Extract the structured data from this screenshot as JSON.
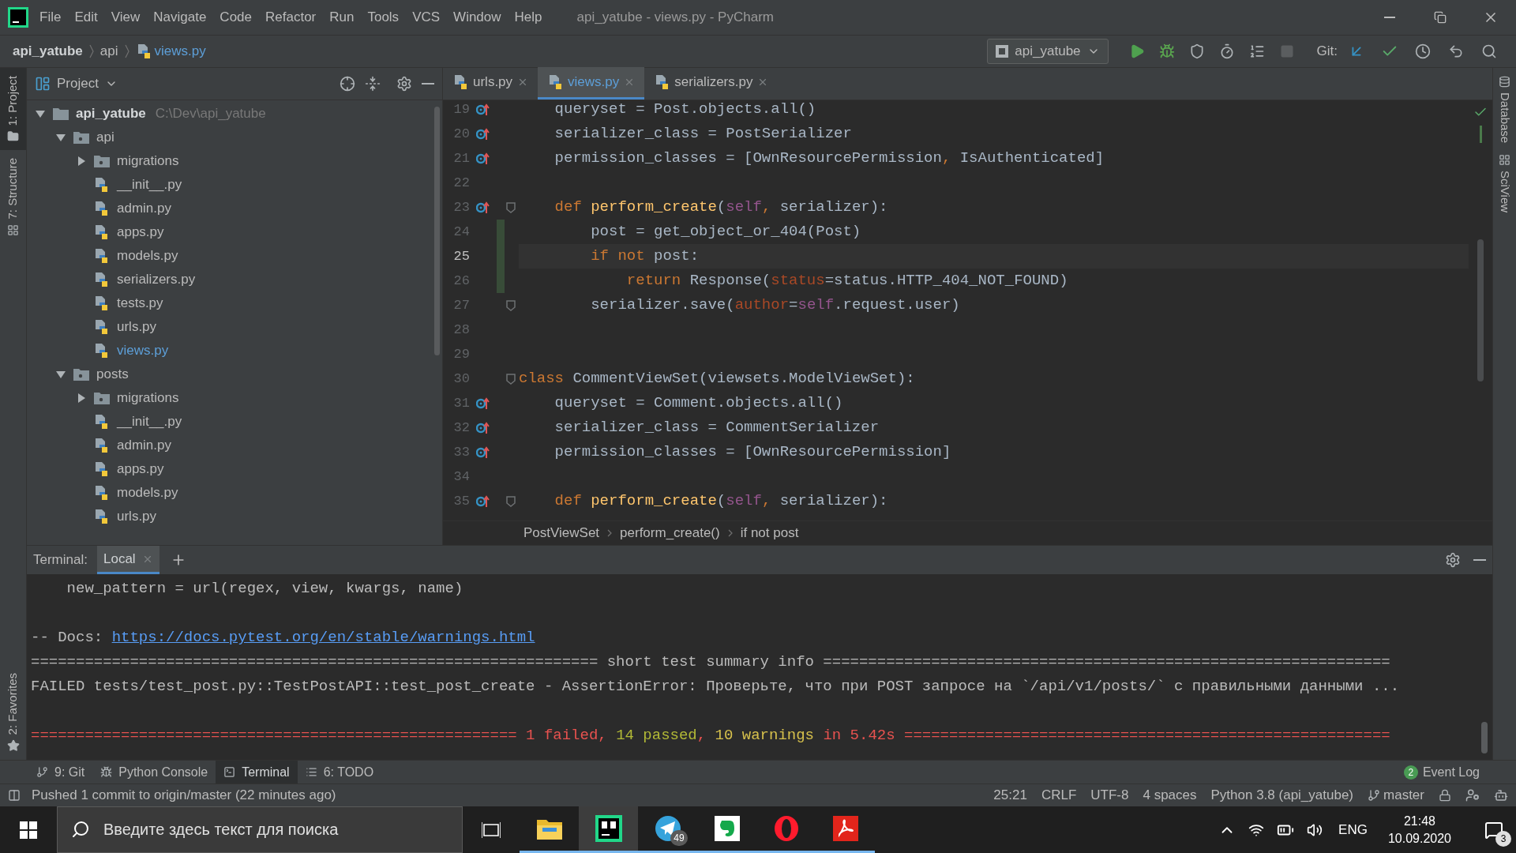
{
  "window": {
    "title": "api_yatube - views.py - PyCharm"
  },
  "menu": [
    "File",
    "Edit",
    "View",
    "Navigate",
    "Code",
    "Refactor",
    "Run",
    "Tools",
    "VCS",
    "Window",
    "Help"
  ],
  "nav": {
    "breadcrumbs": [
      {
        "label": "api_yatube",
        "kind": "project"
      },
      {
        "label": "api",
        "kind": "folder"
      },
      {
        "label": "views.py",
        "kind": "file"
      }
    ],
    "run_config": "api_yatube",
    "run_buttons": [
      {
        "kind": "run",
        "disabled": false
      },
      {
        "kind": "debug",
        "disabled": false
      },
      {
        "kind": "coverage",
        "disabled": false
      },
      {
        "kind": "profile",
        "disabled": false
      },
      {
        "kind": "concurrency",
        "disabled": false
      },
      {
        "kind": "stop",
        "disabled": true
      }
    ],
    "git_label": "Git:"
  },
  "left_strip": [
    {
      "label": "1: Project",
      "selected": true,
      "kind": "project"
    },
    {
      "label": "7: Structure",
      "selected": false,
      "kind": "structure"
    }
  ],
  "left_strip_bottom": [
    {
      "label": "2: Favorites",
      "selected": false,
      "kind": "favorites"
    }
  ],
  "right_strip": [
    {
      "label": "Database",
      "kind": "database"
    },
    {
      "label": "SciView",
      "kind": "sciview"
    }
  ],
  "project": {
    "title": "Project",
    "tree": [
      {
        "label": "api_yatube",
        "hint": "C:\\Dev\\api_yatube",
        "kind": "project",
        "expanded": true,
        "children": [
          {
            "label": "api",
            "kind": "package",
            "expanded": true,
            "children": [
              {
                "label": "migrations",
                "kind": "package",
                "expanded": false
              },
              {
                "label": "__init__.py",
                "kind": "file",
                "active": false
              },
              {
                "label": "admin.py",
                "kind": "file",
                "active": false
              },
              {
                "label": "apps.py",
                "kind": "file",
                "active": false
              },
              {
                "label": "models.py",
                "kind": "file",
                "active": false
              },
              {
                "label": "serializers.py",
                "kind": "file",
                "active": false
              },
              {
                "label": "tests.py",
                "kind": "file",
                "active": false
              },
              {
                "label": "urls.py",
                "kind": "file",
                "active": false
              },
              {
                "label": "views.py",
                "kind": "file",
                "active": true
              }
            ]
          },
          {
            "label": "posts",
            "kind": "package",
            "expanded": true,
            "children": [
              {
                "label": "migrations",
                "kind": "package",
                "expanded": false
              },
              {
                "label": "__init__.py",
                "kind": "file",
                "active": false
              },
              {
                "label": "admin.py",
                "kind": "file",
                "active": false
              },
              {
                "label": "apps.py",
                "kind": "file",
                "active": false
              },
              {
                "label": "models.py",
                "kind": "file",
                "active": false
              },
              {
                "label": "urls.py",
                "kind": "file",
                "active": false
              }
            ]
          }
        ]
      }
    ]
  },
  "editor": {
    "tabs": [
      {
        "label": "urls.py",
        "selected": false
      },
      {
        "label": "views.py",
        "selected": true
      },
      {
        "label": "serializers.py",
        "selected": false
      }
    ],
    "lines": [
      {
        "number": "19",
        "override": true,
        "fold": false,
        "changed": false,
        "current": false,
        "tokens": [
          {
            "kind": "plain",
            "text": "    queryset = Post.objects.all()"
          }
        ]
      },
      {
        "number": "20",
        "override": true,
        "fold": false,
        "changed": false,
        "current": false,
        "tokens": [
          {
            "kind": "plain",
            "text": "    serializer_class = PostSerializer"
          }
        ]
      },
      {
        "number": "21",
        "override": true,
        "fold": false,
        "changed": false,
        "current": false,
        "tokens": [
          {
            "kind": "plain",
            "text": "    permission_classes = [OwnResourcePermission"
          },
          {
            "kind": "keyword",
            "text": ","
          },
          {
            "kind": "plain",
            "text": " IsAuthenticated]"
          }
        ]
      },
      {
        "number": "22",
        "override": false,
        "fold": false,
        "changed": false,
        "current": false
      },
      {
        "number": "23",
        "override": true,
        "fold": true,
        "changed": false,
        "current": false,
        "tokens": [
          {
            "kind": "keyword",
            "text": "    def "
          },
          {
            "kind": "function",
            "text": "perform_create"
          },
          {
            "kind": "plain",
            "text": "("
          },
          {
            "kind": "self",
            "text": "self"
          },
          {
            "kind": "keyword",
            "text": ","
          },
          {
            "kind": "plain",
            "text": " serializer):"
          }
        ]
      },
      {
        "number": "24",
        "override": false,
        "fold": false,
        "changed": true,
        "current": false,
        "tokens": [
          {
            "kind": "plain",
            "text": "        post = get_object_or_404(Post)"
          }
        ]
      },
      {
        "number": "25",
        "override": false,
        "fold": false,
        "changed": true,
        "current": true,
        "tokens": [
          {
            "kind": "keyword",
            "text": "        if not"
          },
          {
            "kind": "plain",
            "text": " post:"
          }
        ]
      },
      {
        "number": "26",
        "override": false,
        "fold": false,
        "changed": true,
        "current": false,
        "tokens": [
          {
            "kind": "keyword",
            "text": "            return"
          },
          {
            "kind": "plain",
            "text": " Response("
          },
          {
            "kind": "param",
            "text": "status"
          },
          {
            "kind": "plain",
            "text": "=status.HTTP_404_NOT_FOUND)"
          }
        ]
      },
      {
        "number": "27",
        "override": false,
        "fold": true,
        "changed": false,
        "current": false,
        "tokens": [
          {
            "kind": "plain",
            "text": "        serializer.save("
          },
          {
            "kind": "param",
            "text": "author"
          },
          {
            "kind": "plain",
            "text": "="
          },
          {
            "kind": "self",
            "text": "self"
          },
          {
            "kind": "plain",
            "text": ".request.user)"
          }
        ]
      },
      {
        "number": "28",
        "override": false,
        "fold": false,
        "changed": false,
        "current": false
      },
      {
        "number": "29",
        "override": false,
        "fold": false,
        "changed": false,
        "current": false
      },
      {
        "number": "30",
        "override": false,
        "fold": true,
        "changed": false,
        "current": false,
        "tokens": [
          {
            "kind": "keyword",
            "text": "class"
          },
          {
            "kind": "plain",
            "text": " CommentViewSet(viewsets.ModelViewSet):"
          }
        ]
      },
      {
        "number": "31",
        "override": true,
        "fold": false,
        "changed": false,
        "current": false,
        "tokens": [
          {
            "kind": "plain",
            "text": "    queryset = Comment.objects.all()"
          }
        ]
      },
      {
        "number": "32",
        "override": true,
        "fold": false,
        "changed": false,
        "current": false,
        "tokens": [
          {
            "kind": "plain",
            "text": "    serializer_class = CommentSerializer"
          }
        ]
      },
      {
        "number": "33",
        "override": true,
        "fold": false,
        "changed": false,
        "current": false,
        "tokens": [
          {
            "kind": "plain",
            "text": "    permission_classes = [OwnResourcePermission]"
          }
        ]
      },
      {
        "number": "34",
        "override": false,
        "fold": false,
        "changed": false,
        "current": false
      },
      {
        "number": "35",
        "override": true,
        "fold": true,
        "changed": false,
        "current": false,
        "tokens": [
          {
            "kind": "keyword",
            "text": "    def "
          },
          {
            "kind": "function",
            "text": "perform_create"
          },
          {
            "kind": "plain",
            "text": "("
          },
          {
            "kind": "self",
            "text": "self"
          },
          {
            "kind": "keyword",
            "text": ","
          },
          {
            "kind": "plain",
            "text": " serializer):"
          }
        ]
      }
    ],
    "breadcrumbs": [
      "PostViewSet",
      "perform_create()",
      "if not post"
    ]
  },
  "terminal": {
    "label": "Terminal:",
    "tabs": [
      {
        "label": "Local",
        "selected": true
      }
    ],
    "lines": [
      {
        "kind": "text",
        "text": "    new_pattern = url(regex, view, kwargs, name)"
      },
      {
        "kind": "blank"
      },
      {
        "kind": "docs",
        "text": "-- Docs: ",
        "link": "https://docs.pytest.org/en/stable/warnings.html"
      },
      {
        "kind": "text",
        "text": "=============================================================== short test summary info ==============================================================="
      },
      {
        "kind": "text",
        "text": "FAILED tests/test_post.py::TestPostAPI::test_post_create - AssertionError: Проверьте, что при POST запросе на `/api/v1/posts/` с правильными данными ..."
      },
      {
        "kind": "blank"
      },
      {
        "kind": "result",
        "segments": [
          {
            "text": "====================================================== 1 failed, ",
            "color": "#e8524f"
          },
          {
            "text": "14 passed",
            "color": "#b2b936"
          },
          {
            "text": ", ",
            "color": "#e8524f"
          },
          {
            "text": "10 warnings",
            "color": "#d7c14c"
          },
          {
            "text": " in 5.42s ======================================================",
            "color": "#e8524f"
          }
        ]
      }
    ]
  },
  "tool_buttons": [
    {
      "label": "9: Git",
      "kind": "git",
      "selected": false
    },
    {
      "label": "Python Console",
      "kind": "console",
      "selected": false
    },
    {
      "label": "Terminal",
      "kind": "terminal",
      "selected": true
    },
    {
      "label": "6: TODO",
      "kind": "todo",
      "selected": false
    }
  ],
  "event_log": {
    "label": "Event Log",
    "count": "2"
  },
  "status_bar": {
    "message": "Pushed 1 commit to origin/master (22 minutes ago)",
    "items": [
      "25:21",
      "CRLF",
      "UTF-8",
      "4 spaces",
      "Python 3.8 (api_yatube)"
    ],
    "branch": "master"
  },
  "taskbar": {
    "search": {
      "placeholder": "Введите здесь текст для поиска"
    },
    "apps": [
      {
        "kind": "folder",
        "active": false
      },
      {
        "kind": "ide",
        "active": true
      },
      {
        "kind": "plane",
        "active": false,
        "badge": "49"
      },
      {
        "kind": "leaf",
        "active": false
      },
      {
        "kind": "ring",
        "active": false
      },
      {
        "kind": "document",
        "active": false
      }
    ],
    "language": "ENG",
    "time": "21:48",
    "date": "10.09.2020",
    "notifications": "3"
  }
}
